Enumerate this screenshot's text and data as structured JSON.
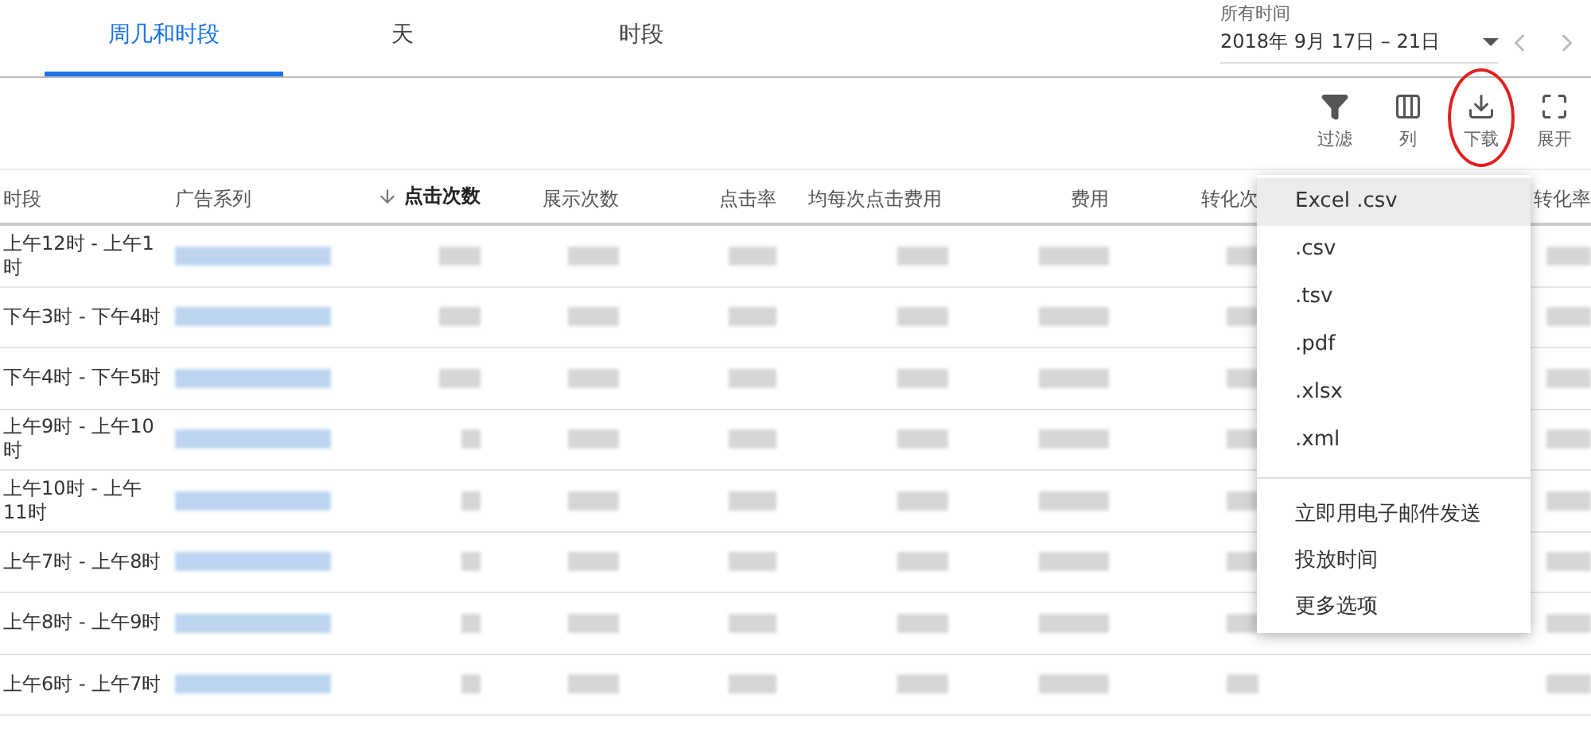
{
  "tabs": [
    {
      "label": "周几和时段",
      "selected": true
    },
    {
      "label": "天",
      "selected": false
    },
    {
      "label": "时段",
      "selected": false
    }
  ],
  "date_range": {
    "label": "所有时间",
    "value": "2018年 9月 17日 – 21日"
  },
  "toolbar": [
    {
      "kind": "filter",
      "label": "过滤"
    },
    {
      "kind": "columns",
      "label": "列"
    },
    {
      "kind": "download",
      "label": "下载",
      "highlighted": true
    },
    {
      "kind": "expand",
      "label": "展开"
    }
  ],
  "table": {
    "columns": [
      {
        "label": "时段",
        "sorted": false
      },
      {
        "label": "广告系列",
        "sorted": false
      },
      {
        "label": "点击次数",
        "sorted": true
      },
      {
        "label": "展示次数",
        "sorted": false
      },
      {
        "label": "点击率",
        "sorted": false
      },
      {
        "label": "均每次点击费用",
        "sorted": false
      },
      {
        "label": "费用",
        "sorted": false
      },
      {
        "label": "转化次",
        "sorted": false
      },
      {
        "label": "转化率",
        "sorted": false
      }
    ],
    "rows": [
      {
        "time": "上午12时 - 上午1时"
      },
      {
        "time": "下午3时 - 下午4时"
      },
      {
        "time": "下午4时 - 下午5时"
      },
      {
        "time": "上午9时 - 上午10时"
      },
      {
        "time": "上午10时 - 上午11时"
      },
      {
        "time": "上午7时 - 上午8时"
      },
      {
        "time": "上午8时 - 上午9时"
      },
      {
        "time": "上午6时 - 上午7时"
      }
    ]
  },
  "download_menu": {
    "formats": [
      {
        "label": "Excel .csv",
        "selected": true
      },
      {
        "label": ".csv",
        "selected": false
      },
      {
        "label": ".tsv",
        "selected": false
      },
      {
        "label": ".pdf",
        "selected": false
      },
      {
        "label": ".xlsx",
        "selected": false
      },
      {
        "label": ".xml",
        "selected": false
      }
    ],
    "actions": [
      "立即用电子邮件发送",
      "投放时间",
      "更多选项"
    ]
  }
}
